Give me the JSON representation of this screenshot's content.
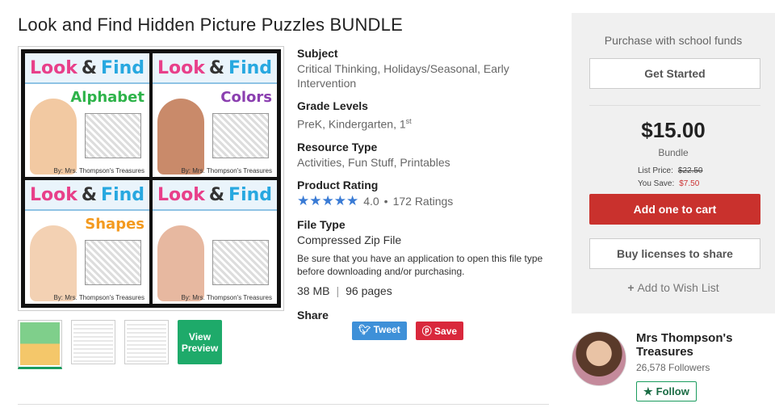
{
  "product": {
    "title": "Look and Find Hidden Picture Puzzles BUNDLE"
  },
  "cover": {
    "tiles": [
      {
        "word1": "Look",
        "amp": "&",
        "word2": "Find",
        "subtitle": "Alphabet",
        "subtitle_color": "#2eb34a",
        "kid_color": "#f2c9a2",
        "byline": "By: Mrs. Thompson's Treasures"
      },
      {
        "word1": "Look",
        "amp": "&",
        "word2": "Find",
        "subtitle": "Colors",
        "subtitle_color": "#8b3fb0",
        "kid_color": "#c98a6a",
        "byline": "By: Mrs. Thompson's Treasures"
      },
      {
        "word1": "Look",
        "amp": "&",
        "word2": "Find",
        "subtitle": "Shapes",
        "subtitle_color": "#f39a1f",
        "kid_color": "#f3d1b3",
        "byline": "By: Mrs. Thompson's Treasures"
      },
      {
        "word1": "Look",
        "amp": "&",
        "word2": "Find",
        "subtitle": "",
        "subtitle_color": "#e8408a",
        "kid_color": "#e7b8a0",
        "byline": "By: Mrs. Thompson's Treasures"
      }
    ]
  },
  "thumbnails": {
    "view_preview_label": "View Preview"
  },
  "details": {
    "subject_label": "Subject",
    "subject_value": "Critical Thinking, Holidays/Seasonal, Early Intervention",
    "grade_label": "Grade Levels",
    "grade_value": "PreK, Kindergarten, 1",
    "grade_sup": "st",
    "resource_label": "Resource Type",
    "resource_value": "Activities, Fun Stuff, Printables",
    "rating_label": "Product Rating",
    "stars": "★★★★★",
    "rating_value": "4.0",
    "rating_count": "172 Ratings",
    "filetype_label": "File Type",
    "filetype_value": "Compressed Zip File",
    "filetype_note": "Be sure that you have an application to open this file type before downloading and/or purchasing.",
    "size": "38 MB",
    "stats_sep": "|",
    "pages": "96 pages",
    "share_label": "Share",
    "tweet_label": "Tweet",
    "save_label": "Save"
  },
  "purchase": {
    "school_funds": "Purchase with school funds",
    "get_started": "Get Started",
    "price": "$15.00",
    "bundle_label": "Bundle",
    "list_price_label": "List Price:",
    "list_price": "$22.50",
    "you_save_label": "You Save:",
    "you_save": "$7.50",
    "add_to_cart": "Add one to cart",
    "buy_licenses": "Buy licenses to share",
    "wish_list": "Add to Wish List"
  },
  "seller": {
    "name": "Mrs Thompson's Treasures",
    "followers": "26,578 Followers",
    "follow_label": "Follow"
  },
  "colors": {
    "accent_green": "#1eaa6a",
    "cart_red": "#c9312d",
    "star_blue": "#3a7bd5"
  }
}
